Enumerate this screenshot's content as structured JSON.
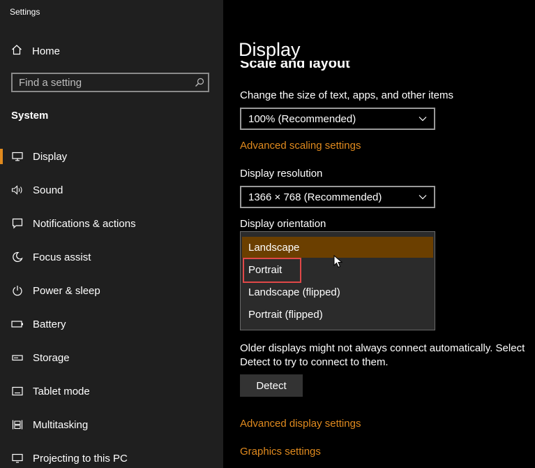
{
  "app": {
    "title": "Settings"
  },
  "sidebar": {
    "home_label": "Home",
    "search_placeholder": "Find a setting",
    "section_label": "System",
    "items": [
      {
        "label": "Display",
        "icon": "monitor-icon",
        "active": true
      },
      {
        "label": "Sound",
        "icon": "speaker-icon"
      },
      {
        "label": "Notifications & actions",
        "icon": "notification-icon"
      },
      {
        "label": "Focus assist",
        "icon": "moon-icon"
      },
      {
        "label": "Power & sleep",
        "icon": "power-icon"
      },
      {
        "label": "Battery",
        "icon": "battery-icon"
      },
      {
        "label": "Storage",
        "icon": "storage-icon"
      },
      {
        "label": "Tablet mode",
        "icon": "tablet-icon"
      },
      {
        "label": "Multitasking",
        "icon": "multitasking-icon"
      },
      {
        "label": "Projecting to this PC",
        "icon": "projecting-icon"
      }
    ]
  },
  "main": {
    "page_title": "Display",
    "section_heading": "Scale and layout",
    "scale": {
      "label": "Change the size of text, apps, and other items",
      "value": "100% (Recommended)",
      "advanced_link": "Advanced scaling settings"
    },
    "resolution": {
      "label": "Display resolution",
      "value": "1366 × 768 (Recommended)"
    },
    "orientation": {
      "label": "Display orientation",
      "options": [
        "Landscape",
        "Portrait",
        "Landscape (flipped)",
        "Portrait (flipped)"
      ],
      "selected": "Landscape",
      "highlighted": "Portrait"
    },
    "detect": {
      "text": "Older displays might not always connect automatically. Select Detect to try to connect to them.",
      "button_label": "Detect"
    },
    "advanced_display_link": "Advanced display settings",
    "graphics_link": "Graphics settings"
  },
  "colors": {
    "accent": "#e08a1e",
    "sidebar_bg": "#1f1f1f",
    "main_bg": "#000000",
    "selected_option": "#6b3f00",
    "highlight_box": "#e04848"
  }
}
